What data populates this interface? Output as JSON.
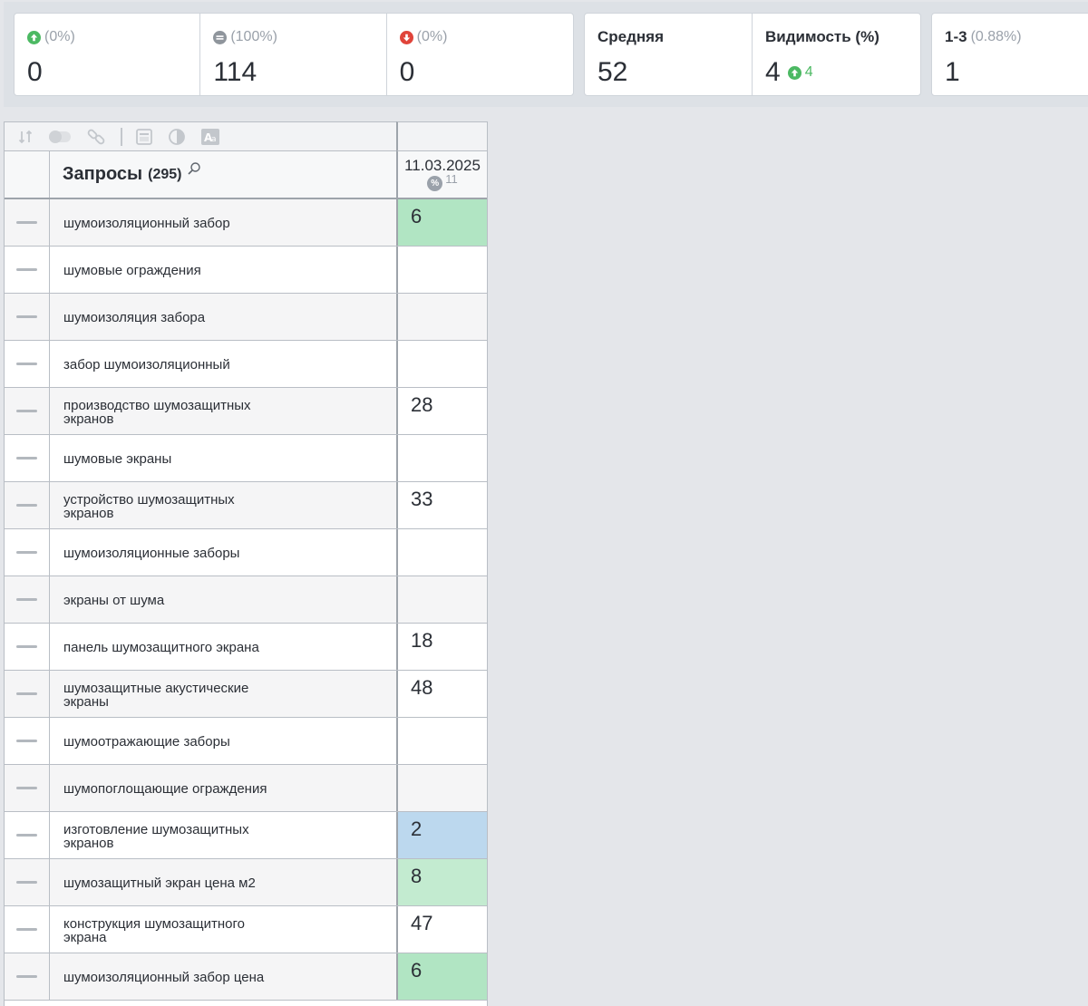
{
  "stats": {
    "group1": [
      {
        "icon": "arrow-up-circle-icon",
        "pct": "(0%)",
        "value": "0"
      },
      {
        "icon": "equal-circle-icon",
        "pct": "(100%)",
        "value": "114"
      },
      {
        "icon": "arrow-down-circle-icon",
        "pct": "(0%)",
        "value": "0"
      }
    ],
    "group2": [
      {
        "title": "Средняя",
        "value": "52"
      },
      {
        "title": "Видимость (%)",
        "value": "4",
        "delta": "4"
      }
    ],
    "group3": [
      {
        "title": "1-3",
        "pct": "(0.88%)",
        "value": "1"
      }
    ]
  },
  "table": {
    "query_header": "Запросы",
    "query_count": "(295)",
    "date_header": "11.03.2025",
    "date_sub_count": "11",
    "rows": [
      {
        "query": "шумоизоляционный забор",
        "position": "6",
        "bg": "#b1e5c3"
      },
      {
        "query": "шумовые ограждения",
        "position": "",
        "bg": ""
      },
      {
        "query": "шумоизоляция забора",
        "position": "",
        "bg": ""
      },
      {
        "query": "забор шумоизоляционный",
        "position": "",
        "bg": ""
      },
      {
        "query": "производство шумозащитных экранов",
        "position": "28",
        "bg": "#ffffff"
      },
      {
        "query": "шумовые экраны",
        "position": "",
        "bg": ""
      },
      {
        "query": "устройство шумозащитных экранов",
        "position": "33",
        "bg": "#ffffff"
      },
      {
        "query": "шумоизоляционные заборы",
        "position": "",
        "bg": ""
      },
      {
        "query": "экраны от шума",
        "position": "",
        "bg": ""
      },
      {
        "query": "панель шумозащитного экрана",
        "position": "18",
        "bg": "#ffffff"
      },
      {
        "query": "шумозащитные акустические экраны",
        "position": "48",
        "bg": "#ffffff"
      },
      {
        "query": "шумоотражающие заборы",
        "position": "",
        "bg": ""
      },
      {
        "query": "шумопоглощающие ограждения",
        "position": "",
        "bg": ""
      },
      {
        "query": "изготовление шумозащитных экранов",
        "position": "2",
        "bg": "#bcd8ee"
      },
      {
        "query": "шумозащитный экран цена м2",
        "position": "8",
        "bg": "#c3ebd0"
      },
      {
        "query": "конструкция шумозащитного экрана",
        "position": "47",
        "bg": "#ffffff"
      },
      {
        "query": "шумоизоляционный забор цена",
        "position": "6",
        "bg": "#b1e5c3"
      }
    ]
  },
  "colors": {
    "up": "#4cb963",
    "down": "#e0443a",
    "neutral": "#8f959c"
  }
}
